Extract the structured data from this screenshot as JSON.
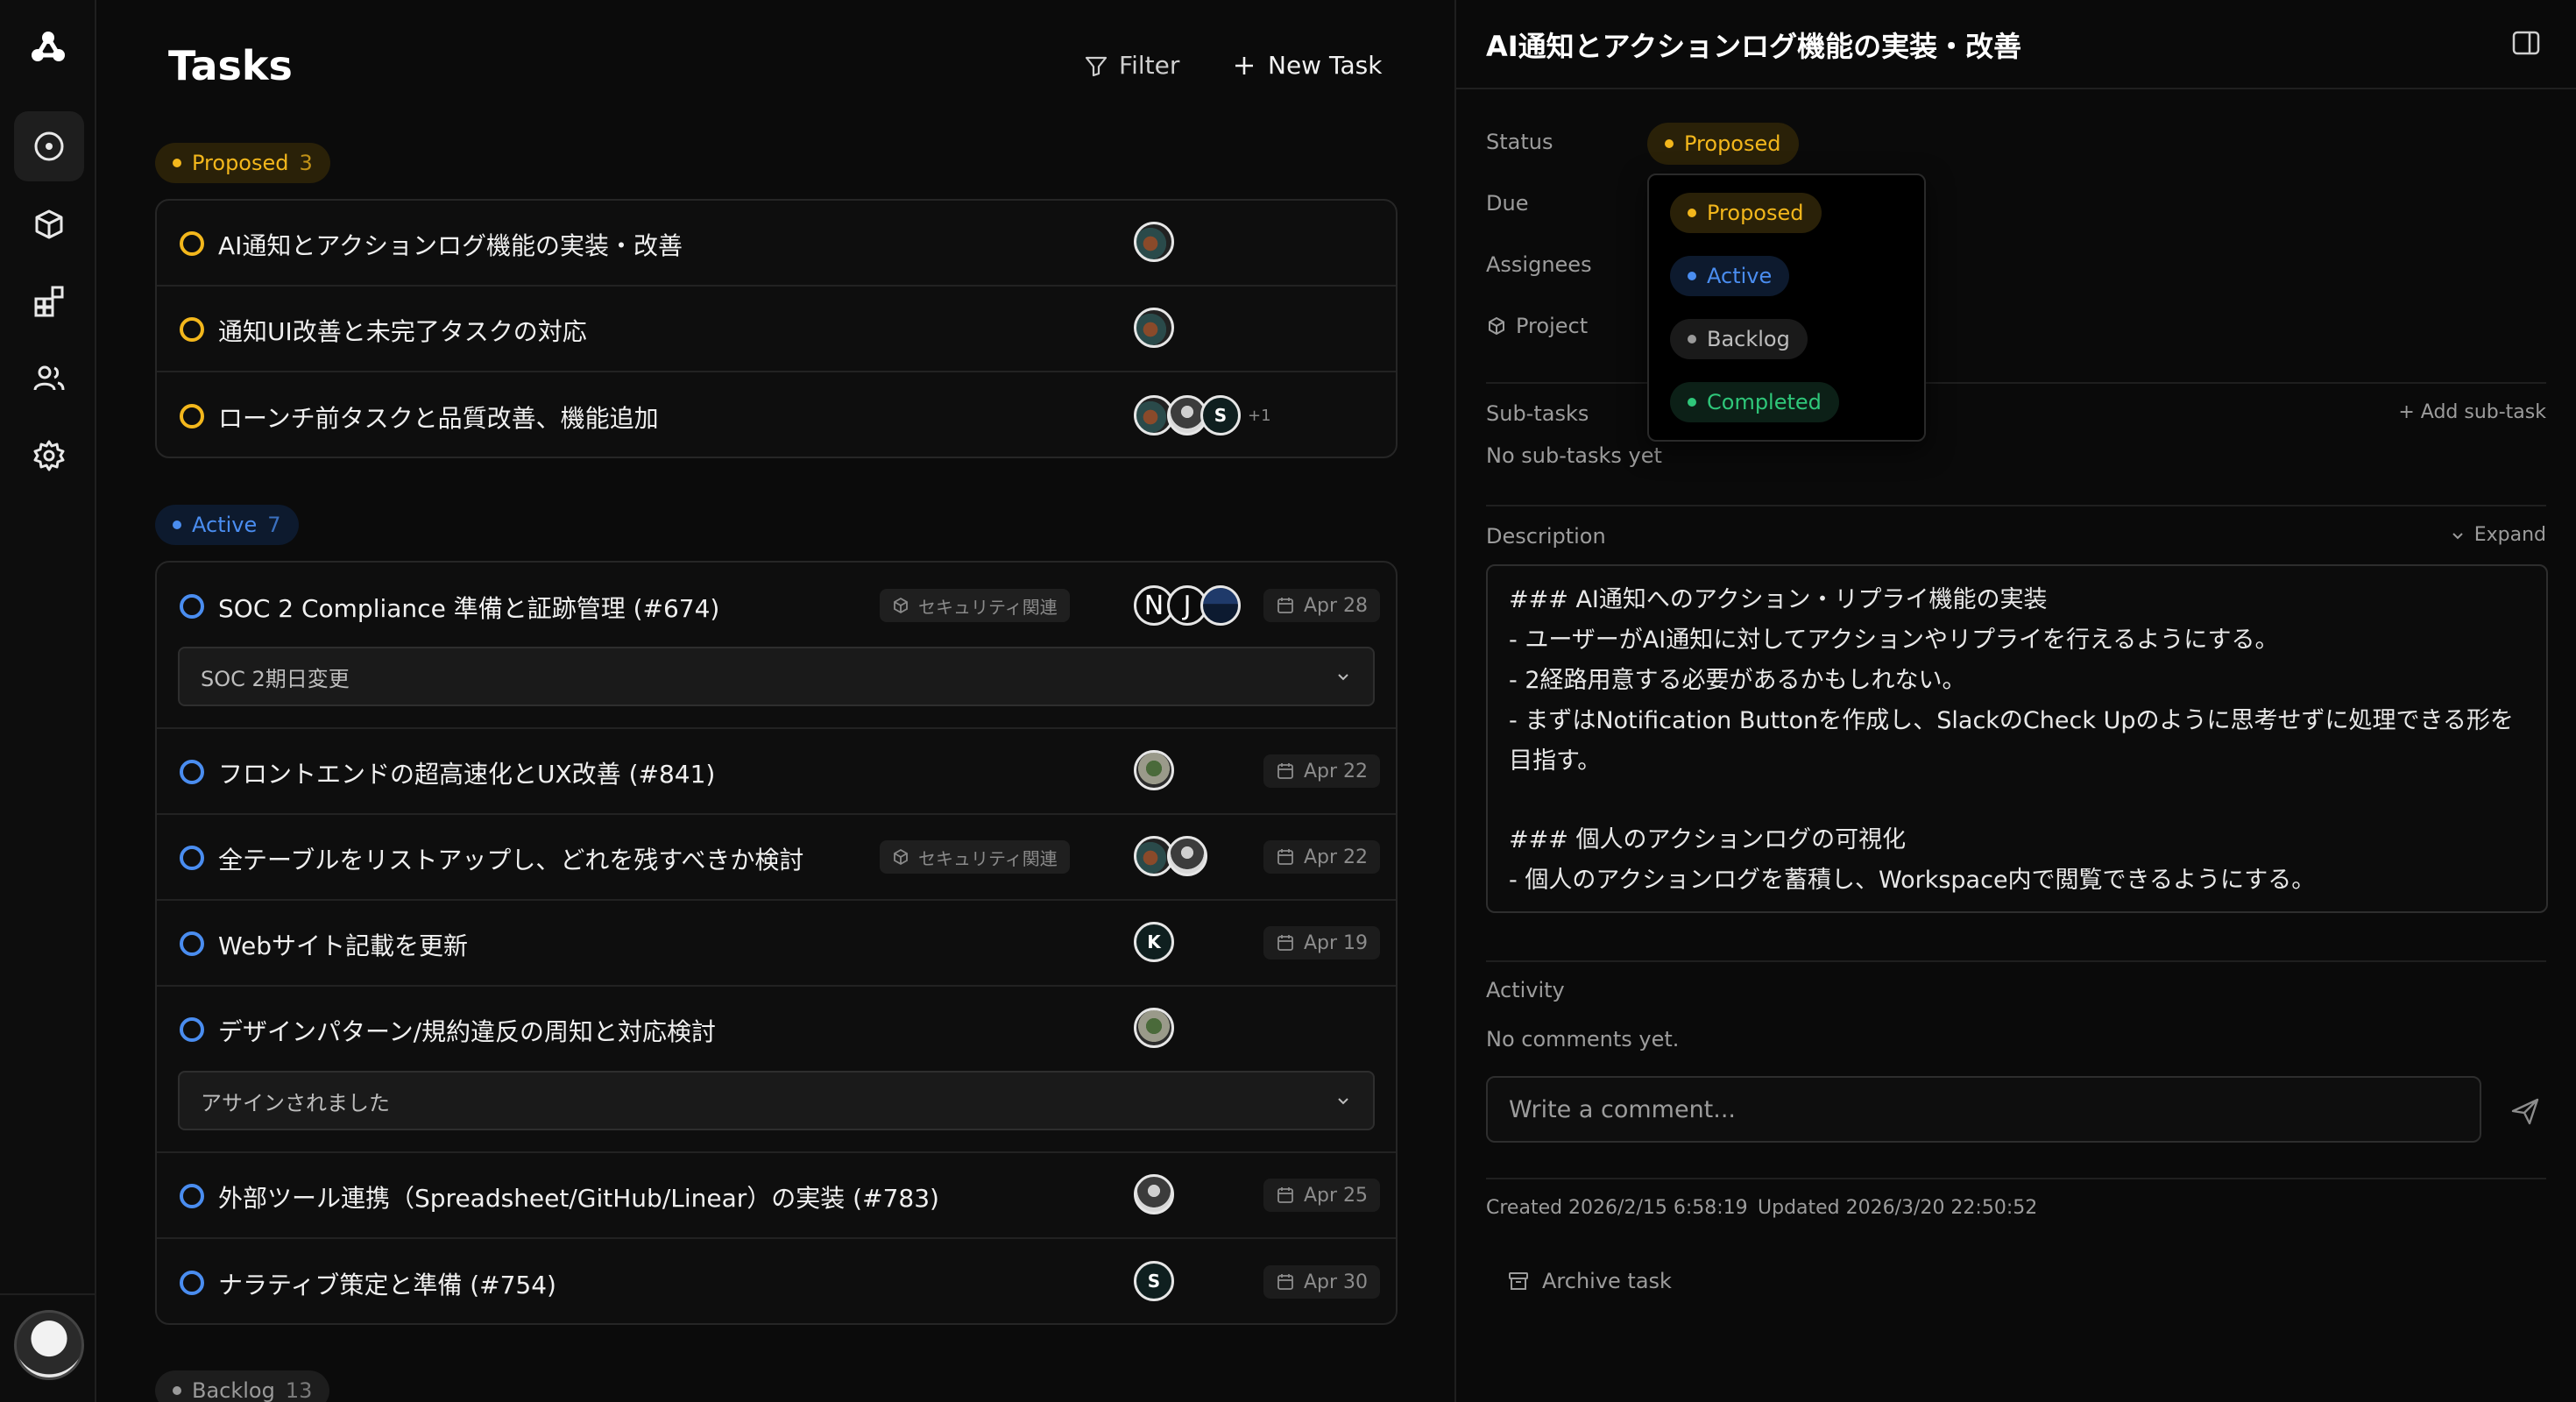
{
  "page": {
    "title": "Tasks"
  },
  "toolbar": {
    "filter_label": "Filter",
    "new_task_label": "New Task"
  },
  "sections": {
    "proposed": {
      "label": "Proposed",
      "count": "3"
    },
    "active": {
      "label": "Active",
      "count": "7"
    },
    "backlog": {
      "label": "Backlog",
      "count": "13"
    }
  },
  "proposed_tasks": [
    {
      "title": "AI通知とアクションログ機能の実装・改善"
    },
    {
      "title": "通知UI改善と未完了タスクの対応"
    },
    {
      "title": "ローンチ前タスクと品質改善、機能追加",
      "extra_assignees": "+1",
      "avatar_letter": "S"
    }
  ],
  "active_tasks": [
    {
      "title": "SOC 2 Compliance 準備と証跡管理 (#674)",
      "tag": "セキュリティ関連",
      "due": "Apr 28",
      "avatar_letters": [
        "N",
        "J"
      ],
      "subitem": "SOC 2期日変更"
    },
    {
      "title": "フロントエンドの超高速化とUX改善 (#841)",
      "due": "Apr 22"
    },
    {
      "title": "全テーブルをリストアップし、どれを残すべきか検討",
      "tag": "セキュリティ関連",
      "due": "Apr 22"
    },
    {
      "title": "Webサイト記載を更新",
      "due": "Apr 19",
      "avatar_letter": "K"
    },
    {
      "title": "デザインパターン/規約違反の周知と対応検討",
      "subitem": "アサインされました"
    },
    {
      "title": "外部ツール連携（Spreadsheet/GitHub/Linear）の実装 (#783)",
      "due": "Apr 25"
    },
    {
      "title": "ナラティブ策定と準備 (#754)",
      "due": "Apr 30",
      "avatar_letter": "S"
    }
  ],
  "detail": {
    "title": "AI通知とアクションログ機能の実装・改善",
    "status_label": "Status",
    "status_value": "Proposed",
    "due_label": "Due",
    "assignees_label": "Assignees",
    "project_label": "Project",
    "status_options": [
      "Proposed",
      "Active",
      "Backlog",
      "Completed"
    ],
    "subtasks_label": "Sub-tasks",
    "add_subtask_label": "+ Add sub-task",
    "no_subtasks": "No sub-tasks yet",
    "description_label": "Description",
    "expand_label": "Expand",
    "description_lines": [
      "### AI通知へのアクション・リプライ機能の実装",
      "- ユーザーがAI通知に対してアクションやリプライを行えるようにする。",
      "- 2経路用意する必要があるかもしれない。",
      "- まずはNotification Buttonを作成し、SlackのCheck Upのように思考せずに処理できる形を",
      "目指す。",
      "",
      "### 個人のアクションログの可視化",
      "- 個人のアクションログを蓄積し、Workspace内で閲覧できるようにする。"
    ],
    "activity_label": "Activity",
    "no_comments": "No comments yet.",
    "comment_placeholder": "Write a comment...",
    "created": "Created 2026/2/15 6:58:19",
    "updated": "Updated 2026/3/20 22:50:52",
    "archive_label": "Archive task"
  },
  "colors": {
    "proposed": "#f3b71c",
    "active": "#4a8df0",
    "backlog": "#9a9a9a",
    "completed": "#2fc77a"
  }
}
